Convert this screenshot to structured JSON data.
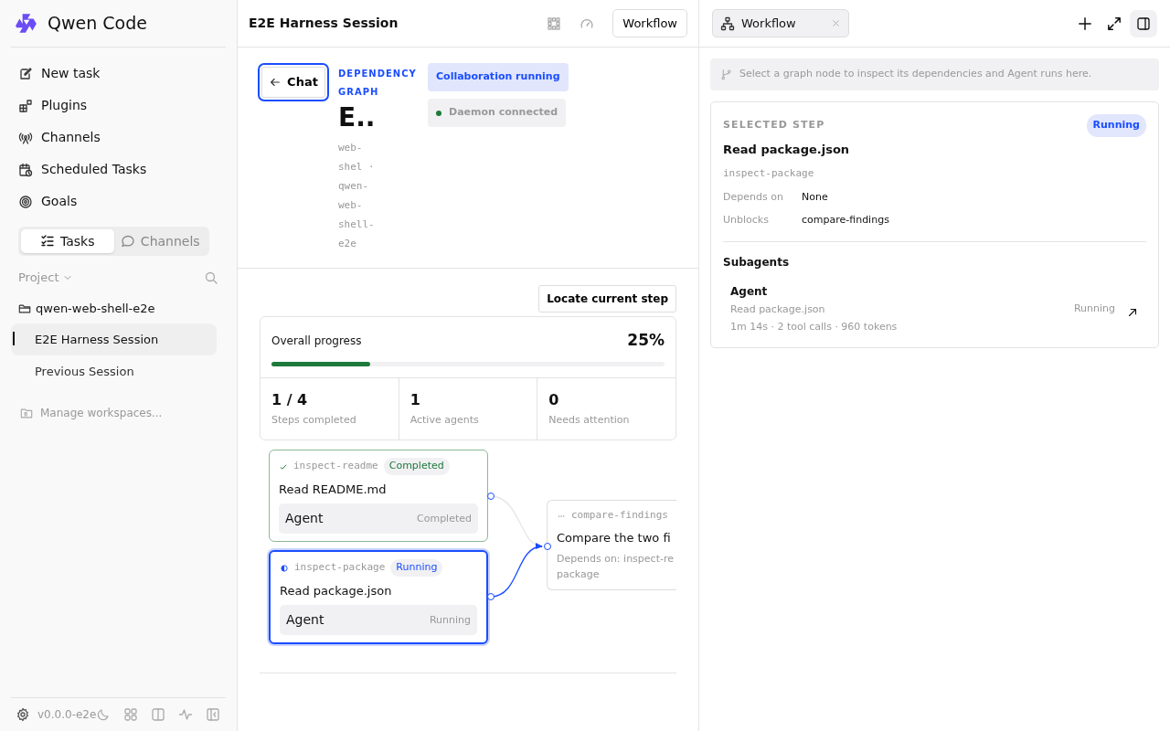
{
  "app": {
    "name": "Qwen Code"
  },
  "nav": [
    {
      "label": "New task",
      "kind": "edit"
    },
    {
      "label": "Plugins",
      "kind": "plugins"
    },
    {
      "label": "Channels",
      "kind": "antenna"
    },
    {
      "label": "Scheduled Tasks",
      "kind": "calendar"
    },
    {
      "label": "Goals",
      "kind": "target"
    }
  ],
  "segments": [
    {
      "label": "Tasks",
      "kind": "tasks",
      "selected": true
    },
    {
      "label": "Channels",
      "kind": "chat",
      "selected": false
    }
  ],
  "project": {
    "label": "Project",
    "folder": "qwen-web-shell-e2e",
    "sessions": [
      {
        "title": "E2E Harness Session",
        "selected": true
      },
      {
        "title": "Previous Session",
        "selected": false
      }
    ],
    "manage": "Manage workspaces..."
  },
  "footer": {
    "version": "v0.0.0-e2e"
  },
  "session": {
    "title": "E2E Harness Session",
    "workflow_button": "Workflow"
  },
  "graph_header": {
    "back": "Chat",
    "eyebrow": "DEPENDENCY GRAPH",
    "title": "E..",
    "subtitle": "web-shel · qwen-web-shell-e2e",
    "badges": [
      {
        "label": "Collaboration running",
        "kind": "running"
      },
      {
        "label": "Daemon connected",
        "kind": "connected"
      }
    ]
  },
  "locate_button": "Locate current step",
  "progress": {
    "label": "Overall progress",
    "percent": "25%",
    "level": 0.25,
    "stats": [
      {
        "value": "1 / 4",
        "label": "Steps completed"
      },
      {
        "value": "1",
        "label": "Active agents"
      },
      {
        "value": "0",
        "label": "Needs attention"
      }
    ]
  },
  "steps": [
    {
      "id": "inspect-readme",
      "kind": "completed",
      "status_label": "Completed",
      "title": "Read README.md",
      "agent": "Agent",
      "agent_status": "Completed",
      "selected": false
    },
    {
      "id": "inspect-package",
      "kind": "running",
      "status_label": "Running",
      "title": "Read package.json",
      "agent": "Agent",
      "agent_status": "Running",
      "selected": true
    },
    {
      "id": "compare-findings",
      "kind": "pending",
      "title": "Compare the two fi",
      "depends": "Depends on: inspect-re package",
      "selected": false
    }
  ],
  "panel": {
    "tab": "Workflow",
    "hint": "Select a graph node to inspect its dependencies and Agent runs here.",
    "eyebrow": "SELECTED STEP",
    "status": "Running",
    "title": "Read package.json",
    "id": "inspect-package",
    "fields": [
      {
        "label": "Depends on",
        "value": "None"
      },
      {
        "label": "Unblocks",
        "value": "compare-findings"
      }
    ],
    "subagents_title": "Subagents",
    "subagents": [
      {
        "name": "Agent",
        "task": "Read package.json",
        "meta": "1m 14s · 2 tool calls · 960 tokens",
        "status": "Running"
      }
    ]
  }
}
